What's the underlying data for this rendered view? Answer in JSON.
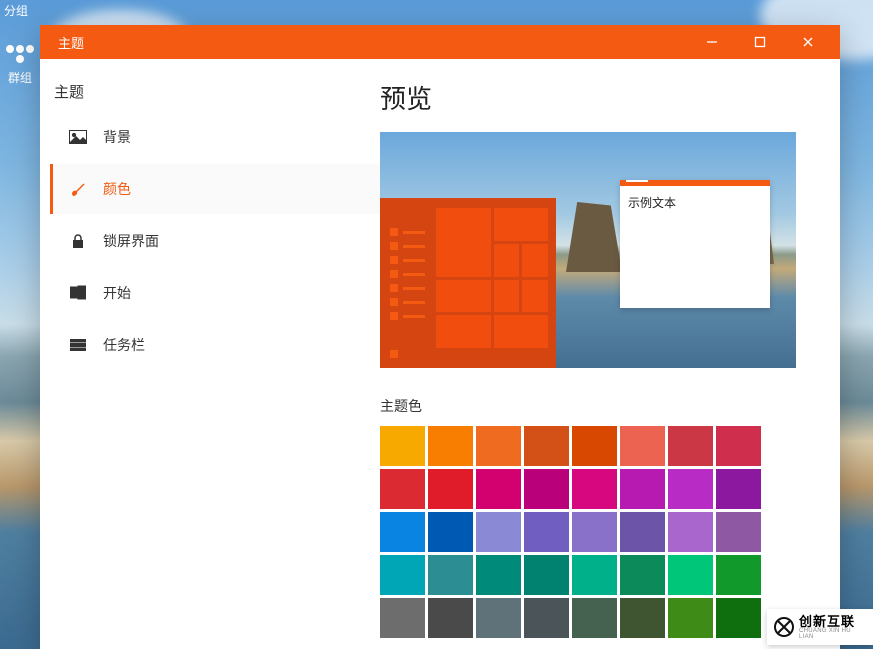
{
  "remnant": {
    "top_tag": "分组",
    "paw_label": "群组"
  },
  "window": {
    "title": "主题"
  },
  "nav": {
    "header": "主题",
    "items": [
      {
        "label": "背景"
      },
      {
        "label": "颜色"
      },
      {
        "label": "锁屏界面"
      },
      {
        "label": "开始"
      },
      {
        "label": "任务栏"
      }
    ],
    "active_index": 1
  },
  "content": {
    "preview_heading": "预览",
    "sample_text": "示例文本",
    "theme_color_label": "主题色"
  },
  "swatches": [
    "#f8a900",
    "#f77e00",
    "#ee6b1f",
    "#d35116",
    "#d84800",
    "#ec6352",
    "#cc3746",
    "#cf2e4d",
    "#dc2a33",
    "#e01b2a",
    "#d3006f",
    "#b9007a",
    "#d7087f",
    "#b71ab0",
    "#b82bc4",
    "#8b189e",
    "#0984e3",
    "#0059b2",
    "#8a89d6",
    "#705fc1",
    "#8971c9",
    "#6c54a8",
    "#a966cc",
    "#8e58a3",
    "#00a6b5",
    "#2c8d92",
    "#008a7a",
    "#018170",
    "#00b08b",
    "#0d8a5a",
    "#00c67a",
    "#11992b",
    "#6d6d6d",
    "#4a4a4a",
    "#5f7179",
    "#4a5459",
    "#44624f",
    "#3f5430",
    "#3e8c17",
    "#0f6e0d"
  ],
  "brand": {
    "name": "创新互联",
    "sub": "CHUANG XIN HU LIAN"
  }
}
